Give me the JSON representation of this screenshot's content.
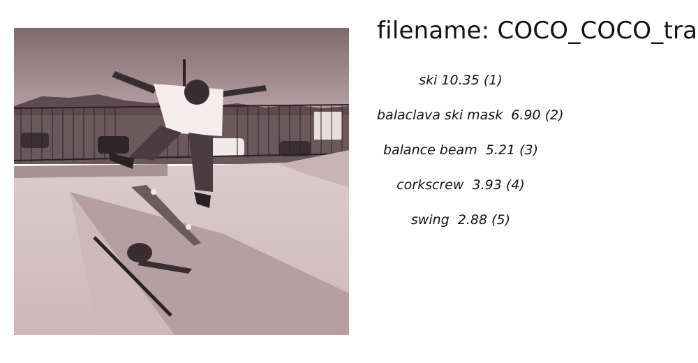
{
  "filename_label": "filename: COCO_COCO_train",
  "predictions": [
    {
      "text": "ski 10.35 (1)"
    },
    {
      "text": "balaclava ski mask  6.90 (2)"
    },
    {
      "text": "balance beam  5.21 (3)"
    },
    {
      "text": "corkscrew  3.93 (4)"
    },
    {
      "text": "swing  2.88 (5)"
    }
  ],
  "colors": {
    "photo_tint": "#d8c2c4",
    "photo_sky": "#9a8487",
    "photo_ground": "#d9c8ca"
  }
}
